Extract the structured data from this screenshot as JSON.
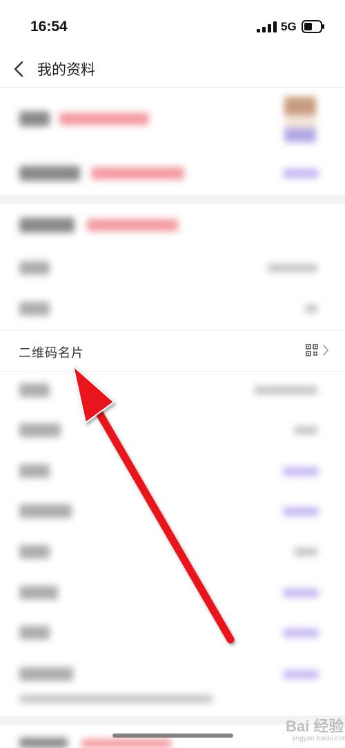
{
  "status_bar": {
    "time": "16:54",
    "network": "5G"
  },
  "nav": {
    "title": "我的资料"
  },
  "qr_row": {
    "label": "二维码名片"
  },
  "watermark": {
    "brand": "Bai  经验",
    "site": "jingyan.baidu.com"
  },
  "colors": {
    "annotation_arrow": "#e8141c",
    "blurred_red": "#f39aa0",
    "blurred_purple": "#c7b8f3"
  }
}
